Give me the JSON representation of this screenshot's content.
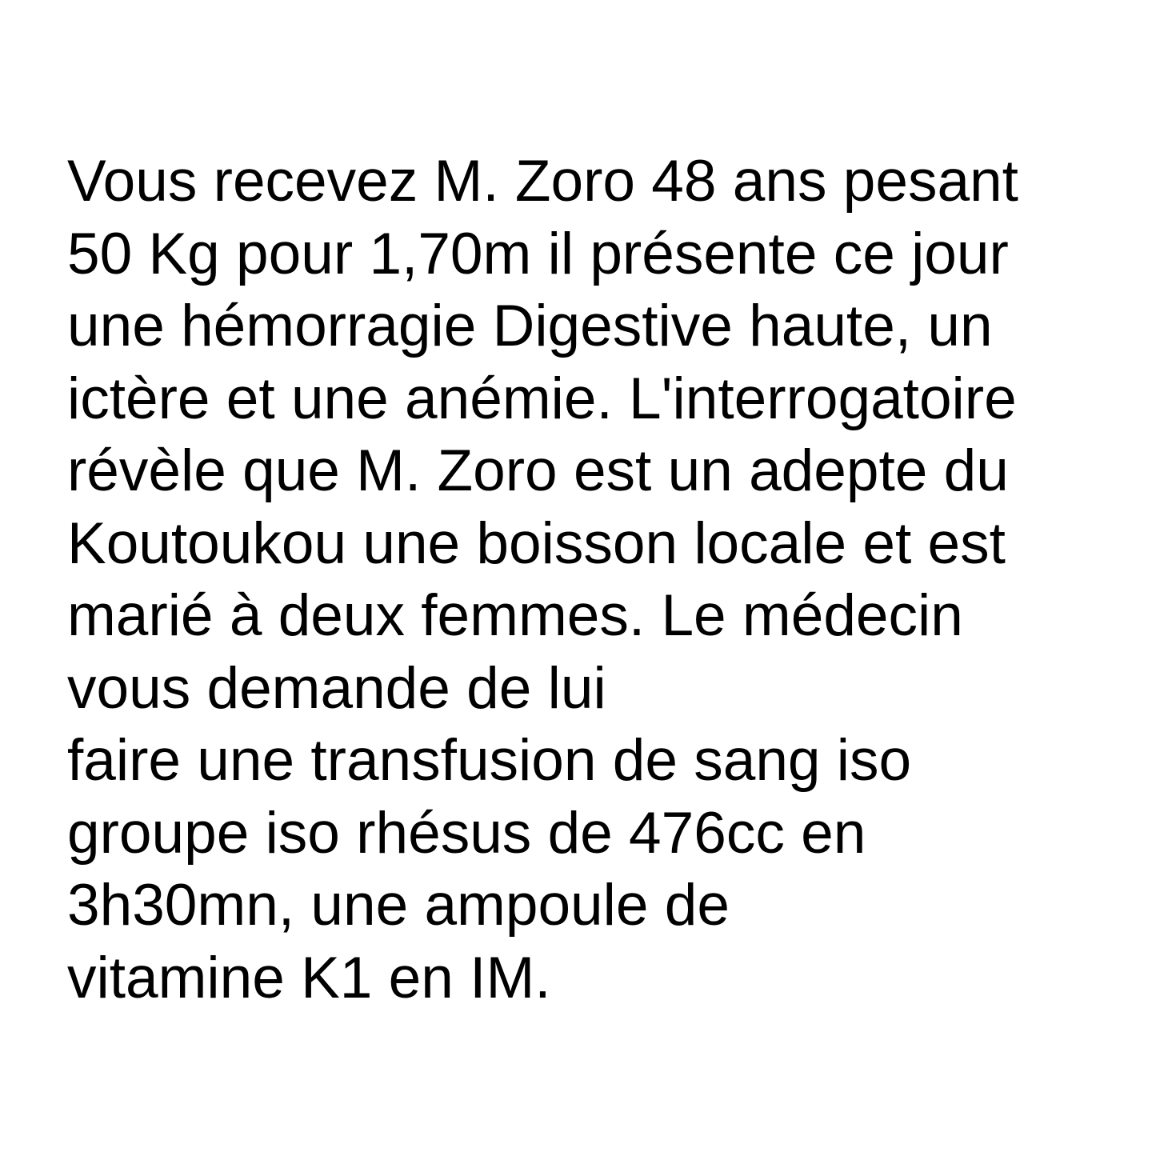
{
  "document": {
    "lines": [
      "Vous recevez M. Zoro 48 ans pesant",
      "50 Kg pour 1,70m il présente ce jour",
      "une hémorragie Digestive haute, un",
      "ictère et une anémie. L'interrogatoire",
      "révèle que M. Zoro est un adepte du",
      "Koutoukou une boisson locale et est",
      "marié à deux femmes. Le médecin",
      "vous demande de lui",
      "faire une transfusion de sang iso",
      "groupe iso rhésus de 476cc en",
      "3h30mn, une ampoule de",
      "vitamine K1 en IM."
    ]
  }
}
